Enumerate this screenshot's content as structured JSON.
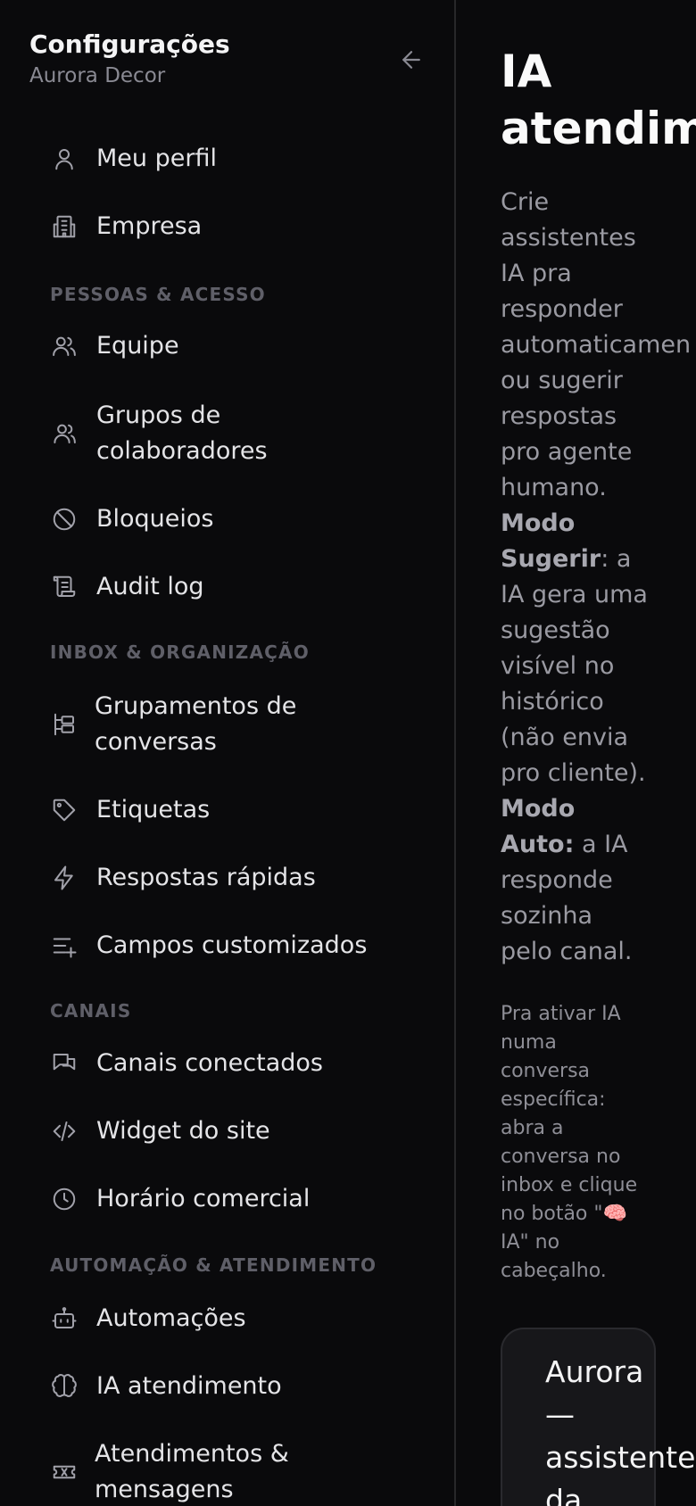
{
  "sidebar": {
    "title": "Configurações",
    "subtitle": "Aurora Decor",
    "back_icon": "arrow-left-icon",
    "items_top": [
      {
        "label": "Meu perfil",
        "icon": "user-icon"
      },
      {
        "label": "Empresa",
        "icon": "building-icon"
      }
    ],
    "sections": [
      {
        "label": "PESSOAS & ACESSO",
        "items": [
          {
            "label": "Equipe",
            "icon": "users-icon"
          },
          {
            "label": "Grupos de\ncolaboradores",
            "icon": "user-group-icon"
          },
          {
            "label": "Bloqueios",
            "icon": "ban-icon"
          },
          {
            "label": "Audit log",
            "icon": "scroll-icon"
          }
        ]
      },
      {
        "label": "INBOX & ORGANIZAÇÃO",
        "items": [
          {
            "label": "Grupamentos de\nconversas",
            "icon": "tree-icon"
          },
          {
            "label": "Etiquetas",
            "icon": "tag-icon"
          },
          {
            "label": "Respostas rápidas",
            "icon": "zap-icon"
          },
          {
            "label": "Campos customizados",
            "icon": "list-plus-icon"
          }
        ]
      },
      {
        "label": "CANAIS",
        "items": [
          {
            "label": "Canais conectados",
            "icon": "messages-icon"
          },
          {
            "label": "Widget do site",
            "icon": "code-icon"
          },
          {
            "label": "Horário comercial",
            "icon": "clock-icon"
          }
        ]
      },
      {
        "label": "AUTOMAÇÃO & ATENDIMENTO",
        "items": [
          {
            "label": "Automações",
            "icon": "bot-icon"
          },
          {
            "label": "IA atendimento",
            "icon": "brain-icon"
          },
          {
            "label": "Atendimentos &\nmensagens",
            "icon": "ticket-icon"
          }
        ]
      }
    ]
  },
  "main": {
    "title": "IA\natendim",
    "description": {
      "intro": "Crie\nassistentes\nIA pra\nresponder\nautomaticamen\nou sugerir\nrespostas\npro agente\nhumano.",
      "mode1_label": "Modo\nSugerir",
      "mode1_text": ": a\nIA gera uma\nsugestão\nvisível no\nhistórico\n(não envia\npro cliente).",
      "mode2_label": "Modo\nAuto:",
      "mode2_text": " a IA\nresponde\nsozinha\npelo canal."
    },
    "note": "Pra ativar IA\nnuma\nconversa\nespecífica:\nabra a\nconversa no\ninbox e clique\nno botão \"🧠\nIA\" no\ncabeçalho.",
    "assistant_card": {
      "title": "Aurora\n—\nassistente\nda"
    }
  }
}
